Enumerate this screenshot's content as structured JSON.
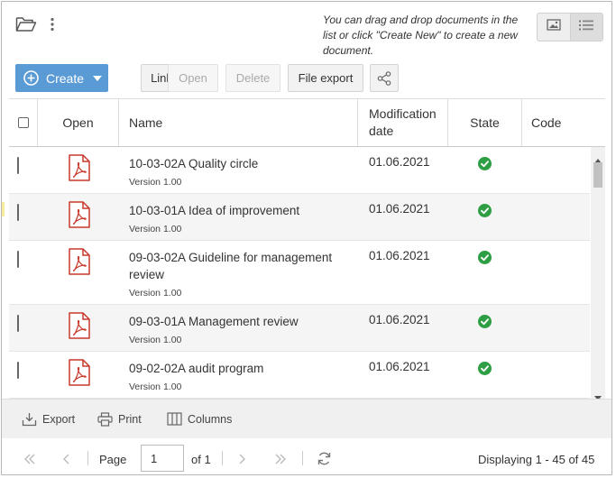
{
  "hint": {
    "line1": "You can drag and drop documents in the",
    "line2": "list or click \"Create New\" to create a new",
    "line3": "document."
  },
  "toolbar": {
    "create_label": "Create",
    "link_label": "Link",
    "open_label": "Open",
    "delete_label": "Delete",
    "file_export_label": "File export"
  },
  "grid": {
    "headers": {
      "open": "Open",
      "name": "Name",
      "modification_line1": "Modification",
      "modification_line2": "date",
      "state": "State",
      "code": "Code"
    },
    "rows": [
      {
        "title": "10-03-02A Quality circle",
        "title2": "",
        "version": "Version 1.00",
        "date": "01.06.2021"
      },
      {
        "title": "10-03-01A Idea of improvement",
        "title2": "",
        "version": "Version 1.00",
        "date": "01.06.2021"
      },
      {
        "title": "09-03-02A Guideline for management",
        "title2": "review",
        "version": "Version 1.00",
        "date": "01.06.2021"
      },
      {
        "title": "09-03-01A Management review",
        "title2": "",
        "version": "Version 1.00",
        "date": "01.06.2021"
      },
      {
        "title": "09-02-02A audit program",
        "title2": "",
        "version": "Version 1.00",
        "date": "01.06.2021"
      }
    ]
  },
  "footer": {
    "export_label": "Export",
    "print_label": "Print",
    "columns_label": "Columns"
  },
  "paging": {
    "page_label": "Page",
    "page_value": "1",
    "of_label": "of 1",
    "display_text": "Displaying 1 - 45 of 45"
  },
  "colors": {
    "accent": "#5b9bd5",
    "pdf_red": "#c8392b",
    "state_green": "#2e9e44"
  }
}
